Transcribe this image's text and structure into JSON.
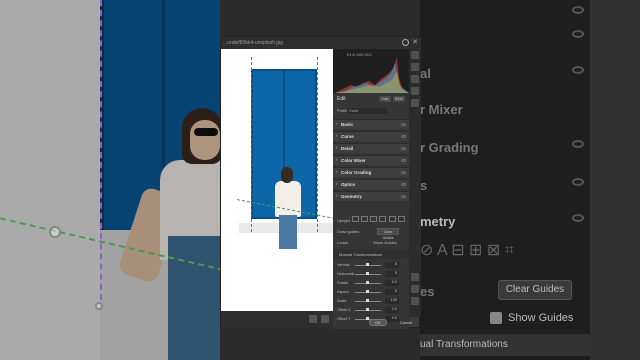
{
  "dialog": {
    "title": "...undef80bk4-unsplash.jpg"
  },
  "histogram": {
    "labels": "f/1.8  1/60  ISO"
  },
  "edit": {
    "label": "Edit",
    "auto_label": "Auto",
    "bw_label": "B&W"
  },
  "profile": {
    "label": "Profile",
    "value": "Color"
  },
  "sections": {
    "basic": "Basic",
    "curve": "Curve",
    "detail": "Detail",
    "color_mixer": "Color Mixer",
    "color_grading": "Color Grading",
    "optics": "Optics",
    "geometry": "Geometry"
  },
  "geometry": {
    "upright_label": "Upright",
    "draw_guides_label": "Draw guides",
    "clear_guides_label": "Clear Guides",
    "loupe_label": "Loupe",
    "show_guides_label": "Show Guides",
    "manual_label": "Manual Transformations",
    "sliders": [
      {
        "label": "Vertical",
        "value": "0"
      },
      {
        "label": "Horizontal",
        "value": "0"
      },
      {
        "label": "Rotate",
        "value": "0.0"
      },
      {
        "label": "Aspect",
        "value": "0"
      },
      {
        "label": "Scale",
        "value": "100"
      },
      {
        "label": "Offset X",
        "value": "0.0"
      },
      {
        "label": "Offset Y",
        "value": "0.0"
      }
    ]
  },
  "footer": {
    "ok": "OK",
    "cancel": "Cancel"
  },
  "right_bg": {
    "rows": [
      "",
      "al",
      "r Mixer",
      "r Grading",
      "s",
      "metry"
    ],
    "clear_guides": "Clear Guides",
    "show_guides": "Show Guides",
    "manual": "ual Transformations",
    "es": "es"
  }
}
